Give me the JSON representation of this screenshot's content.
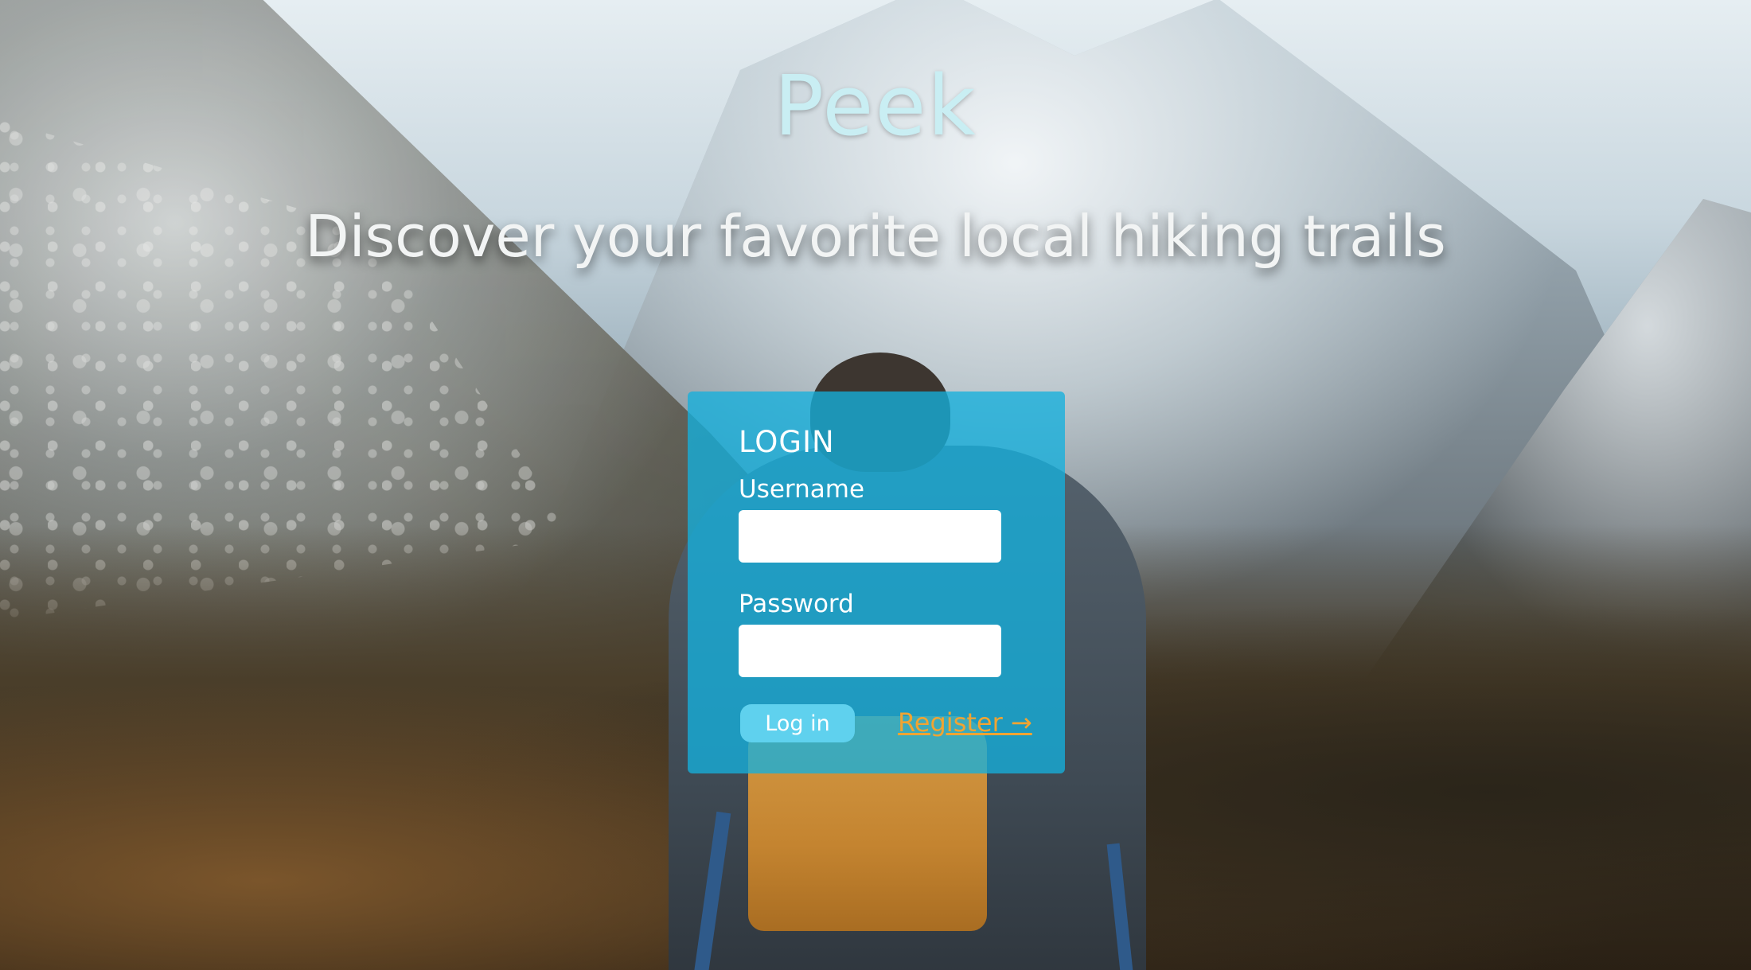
{
  "brand": {
    "name": "Peek"
  },
  "hero": {
    "tagline": "Discover your favorite local hiking trails"
  },
  "login": {
    "title": "LOGIN",
    "username_label": "Username",
    "username_value": "",
    "password_label": "Password",
    "password_value": "",
    "login_button": "Log in",
    "register_link": "Register →"
  },
  "colors": {
    "brand_text": "#c9eef3",
    "card_background": "#14afdc",
    "login_button": "#5fd1ee",
    "register_link": "#f0a432"
  }
}
